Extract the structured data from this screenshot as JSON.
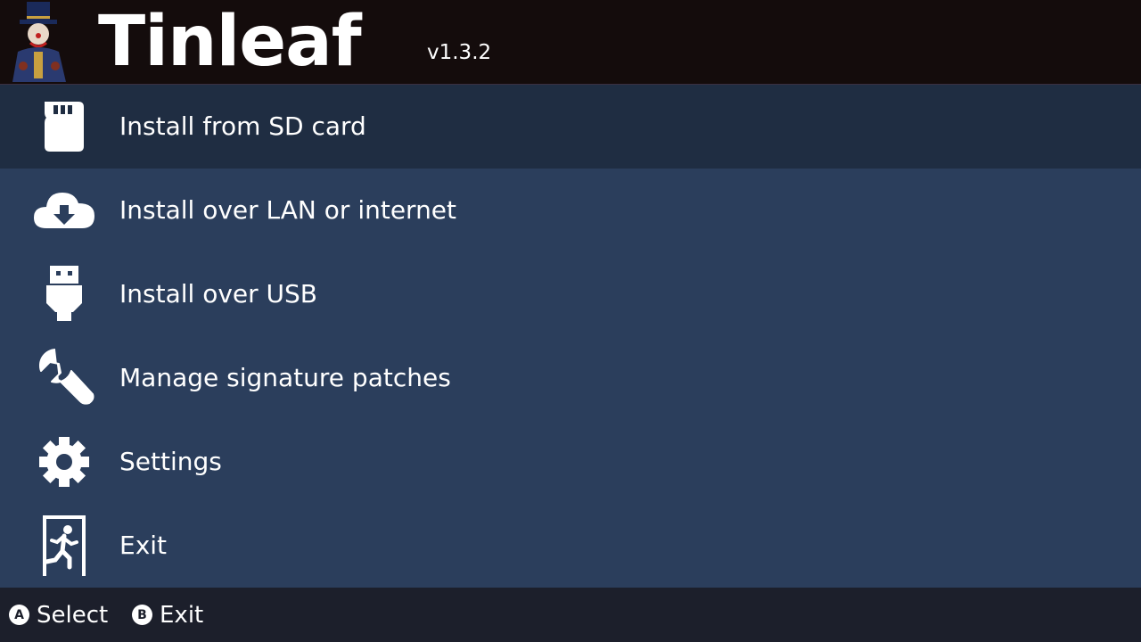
{
  "header": {
    "title": "Tinleaf",
    "version": "v1.3.2"
  },
  "menu": {
    "items": [
      {
        "label": "Install from SD card",
        "icon": "sd-card-icon",
        "selected": true
      },
      {
        "label": "Install over LAN or internet",
        "icon": "cloud-download-icon",
        "selected": false
      },
      {
        "label": "Install over USB",
        "icon": "usb-icon",
        "selected": false
      },
      {
        "label": "Manage signature patches",
        "icon": "wrench-icon",
        "selected": false
      },
      {
        "label": "Settings",
        "icon": "gear-icon",
        "selected": false
      },
      {
        "label": "Exit",
        "icon": "exit-door-icon",
        "selected": false
      }
    ]
  },
  "footer": {
    "hints": [
      {
        "button": "A",
        "label": "Select"
      },
      {
        "button": "B",
        "label": "Exit"
      }
    ]
  },
  "colors": {
    "header_bg": "#140c0c",
    "menu_bg": "#2b3e5c",
    "selected_bg": "#1f2d42",
    "footer_bg": "#1c1f2b",
    "text": "#ffffff"
  }
}
